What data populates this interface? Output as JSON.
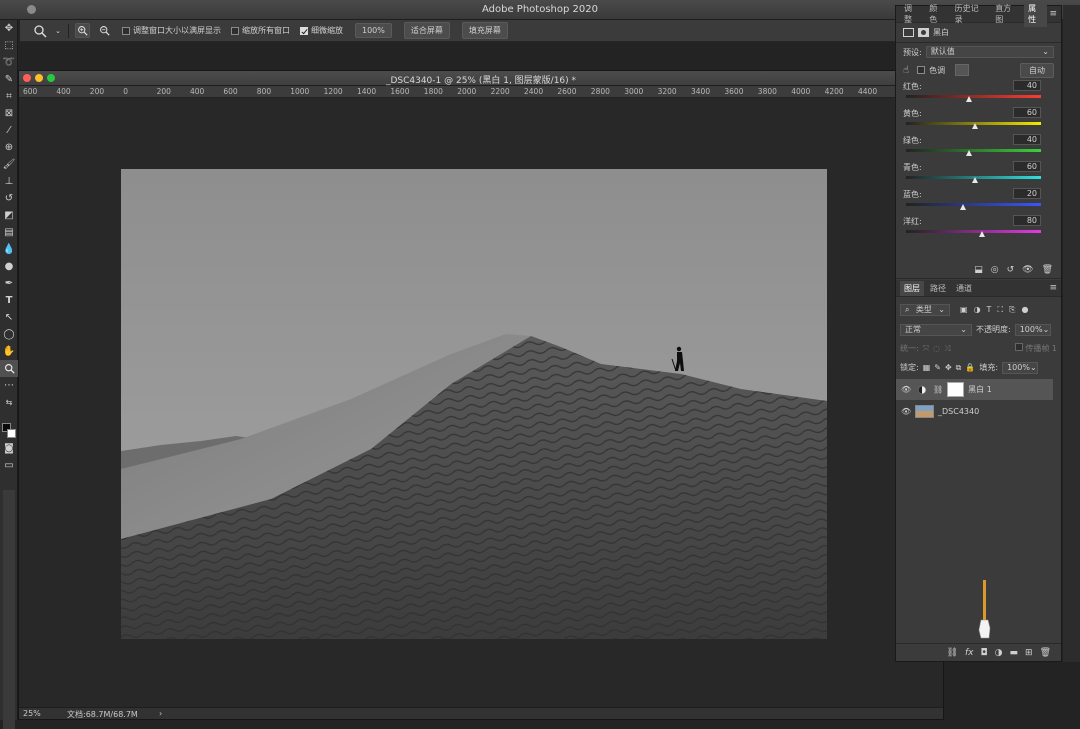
{
  "app": {
    "title": "Adobe Photoshop 2020"
  },
  "options": {
    "cb_resize": "调整窗口大小以满屏显示",
    "cb_zoom_all": "缩放所有窗口",
    "cb_scrubby": "细微缩放",
    "btn_100": "100%",
    "btn_fit": "适合屏幕",
    "btn_fill": "填充屏幕"
  },
  "doc": {
    "title": "_DSC4340-1 @ 25% (黑白 1, 图层蒙版/16) *",
    "ruler": [
      "600",
      "400",
      "200",
      "0",
      "200",
      "400",
      "600",
      "800",
      "1000",
      "1200",
      "1400",
      "1600",
      "1800",
      "2000",
      "2200",
      "2400",
      "2600",
      "2800",
      "3000",
      "3200",
      "3400",
      "3600",
      "3800",
      "4000",
      "4200",
      "4400"
    ],
    "zoom": "25%",
    "docsize": "文档:68.7M/68.7M"
  },
  "panel": {
    "tabs": [
      "调整",
      "颜色",
      "历史记录",
      "直方图",
      "属性"
    ],
    "prop_title": "黑白",
    "preset_label": "预设:",
    "preset_value": "默认值",
    "tint_label": "色调",
    "auto_label": "自动",
    "sliders": [
      {
        "name": "红色:",
        "value": 40,
        "pos": 0.47,
        "grad": "#ff3b30"
      },
      {
        "name": "黄色:",
        "value": 60,
        "pos": 0.51,
        "grad": "#f5e800"
      },
      {
        "name": "绿色:",
        "value": 40,
        "pos": 0.47,
        "grad": "#3bd13b"
      },
      {
        "name": "青色:",
        "value": 60,
        "pos": 0.51,
        "grad": "#2ee0e0"
      },
      {
        "name": "蓝色:",
        "value": 20,
        "pos": 0.42,
        "grad": "#3a55ff"
      },
      {
        "name": "洋红:",
        "value": 80,
        "pos": 0.56,
        "grad": "#e33ae3"
      }
    ]
  },
  "layers_panel": {
    "tabs": [
      "图层",
      "路径",
      "通道"
    ],
    "kind_label": "类型",
    "blend_mode": "正常",
    "opacity_label": "不透明度:",
    "opacity": "100%",
    "unify_label": "统一:",
    "propagate_label": "传播帧 1",
    "lock_label": "锁定:",
    "fill_label": "填充:",
    "fill": "100%",
    "layers": [
      {
        "name": "黑白 1",
        "type": "adjustment"
      },
      {
        "name": "_DSC4340",
        "type": "image"
      }
    ]
  }
}
